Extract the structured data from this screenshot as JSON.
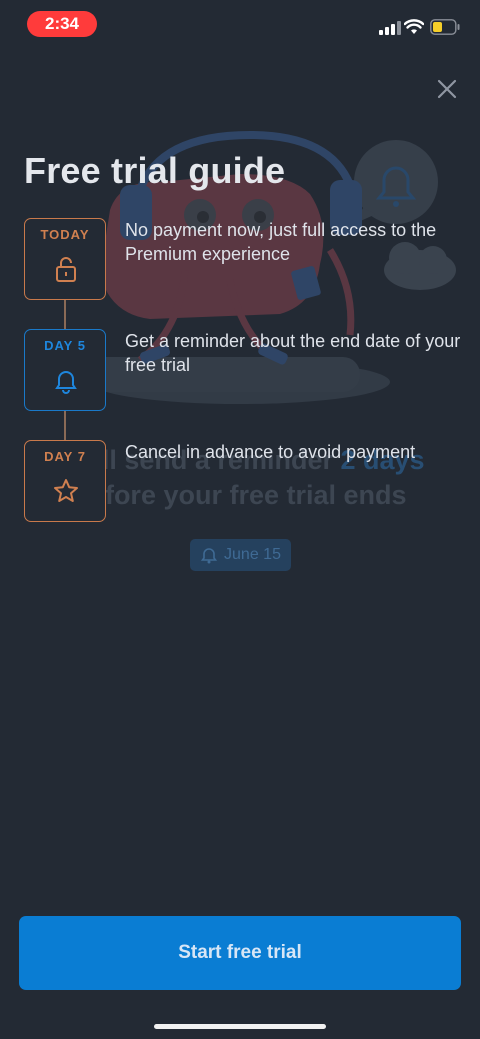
{
  "status_bar": {
    "time": "2:34",
    "colors": {
      "time_pill": "#ff3b3b",
      "battery_fill": "#f5cf2a"
    }
  },
  "header": {
    "title": "Free trial guide",
    "close_icon": "close-icon"
  },
  "background_hint": {
    "line1_prefix": "We'll send a reminder ",
    "line1_highlight": "2 days",
    "line2": "before your free trial ends",
    "date_chip": "June 15"
  },
  "steps": [
    {
      "label": "TODAY",
      "icon": "unlock-icon",
      "text": "No payment now, just full access to the Premium experience",
      "color": "#d08050"
    },
    {
      "label": "DAY 5",
      "icon": "bell-icon",
      "text": "Get a reminder about the end date of your free trial",
      "color": "#1e86dd"
    },
    {
      "label": "DAY 7",
      "icon": "star-icon",
      "text": "Cancel in advance to avoid payment",
      "color": "#d08050"
    }
  ],
  "footer": {
    "start_label": "Start free trial",
    "accent": "#0a7dd3"
  }
}
